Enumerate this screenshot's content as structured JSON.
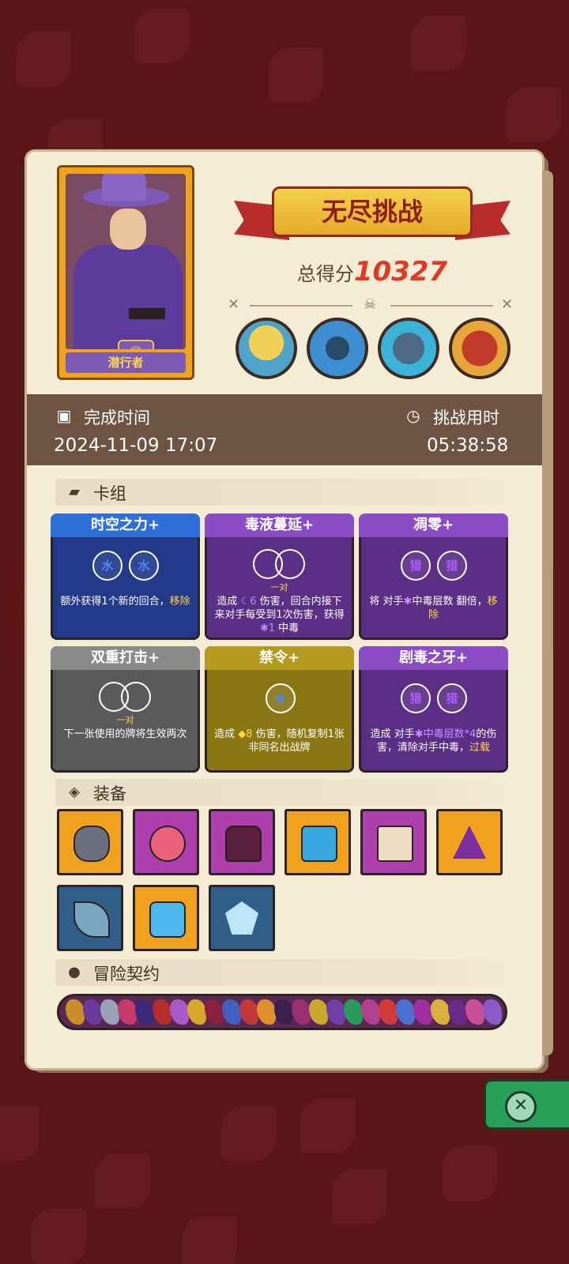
{
  "hero": {
    "name": "潜行者"
  },
  "banner": {
    "title": "无尽挑战"
  },
  "score": {
    "label": "总得分",
    "value": "10327"
  },
  "bosses": [
    "scarecrow-boss",
    "spider-boss",
    "knight-boss",
    "demon-boss"
  ],
  "time": {
    "finish_label": "完成时间",
    "finish_value": "2024-11-09  17:07",
    "duration_label": "挑战用时",
    "duration_value": "05:38:58"
  },
  "deck": {
    "title": "卡组",
    "cards": [
      {
        "name": "时空之力+",
        "symbol_1": "水",
        "symbol_2": "水",
        "text_a": "额外获得1个新的回合，",
        "text_hl": "移除",
        "color": "#233a8a"
      },
      {
        "name": "毒液蔓延+",
        "pair": "一对",
        "text_a": "造成 ",
        "text_b": "6",
        "text_c": " 伤害，回合内接下来对手每受到1次伤害，获得 ",
        "text_d": "1",
        "text_e": " 中毒",
        "color": "#5b2f86"
      },
      {
        "name": "凋零+",
        "symbol_1": "猎",
        "symbol_2": "猎",
        "text_a": "将 对手",
        "text_b": "中毒层数 翻倍，",
        "text_hl": "移除",
        "color": "#5b2f86"
      },
      {
        "name": "双重打击+",
        "pair": "一对",
        "text_a": "下一张使用的牌将生效两次",
        "color": "#5a5a5a"
      },
      {
        "name": "禁令+",
        "symbol_1": "水",
        "text_a": "造成 ",
        "text_b": "8",
        "text_c": " 伤害，随机复制1张非同名出战牌",
        "color": "#8a7612"
      },
      {
        "name": "剧毒之牙+",
        "symbol_1": "猎",
        "symbol_2": "猎",
        "text_a": "造成 对手",
        "text_b": "中毒层数*4",
        "text_c": "的伤害，清除对手中毒，",
        "text_hl": "过载",
        "color": "#5b2f86"
      }
    ]
  },
  "equipment": {
    "title": "装备",
    "items": [
      "moon-stone",
      "spotted-gem",
      "purple-armor",
      "blue-amulet",
      "magic-scroll",
      "eye-potion",
      "scythe-blade",
      "ice-dice",
      "crystal-shard"
    ]
  },
  "contracts": {
    "title": "冒险契约"
  },
  "colors": {
    "accent_red": "#e03a25",
    "highlight": "#ffd54a"
  }
}
